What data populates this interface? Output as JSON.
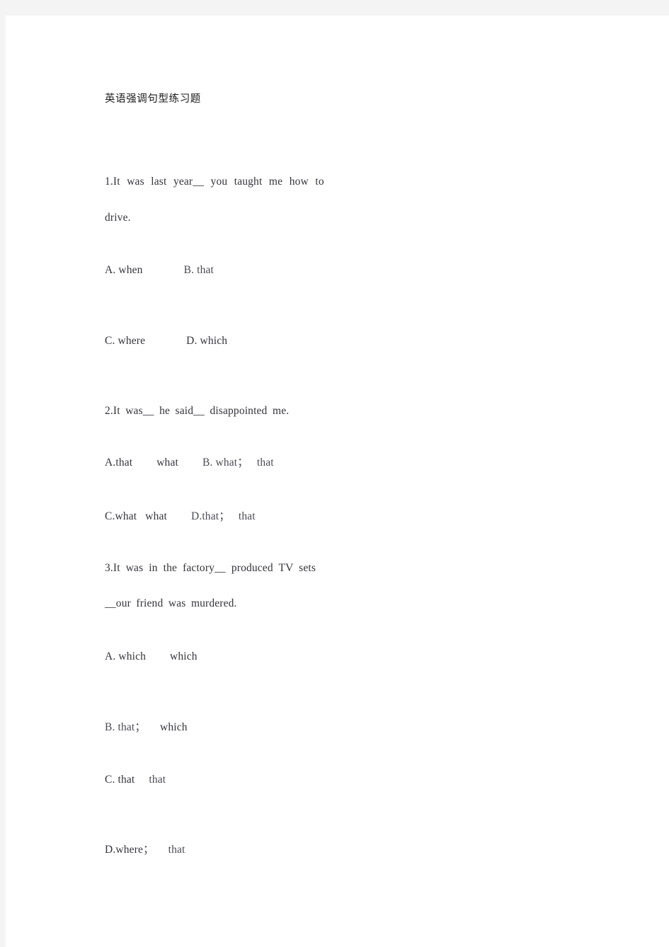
{
  "document": {
    "title": "英语强调句型练习题",
    "questions": [
      {
        "stem_line_1": "1.It was last year__ you taught me how to",
        "stem_line_2": "drive.",
        "option_a_label": "A. when",
        "option_b_label": "B. that",
        "option_c_label": "C. where",
        "option_d_label": "D. which"
      },
      {
        "stem_line_1": "2.It was__ he said__ disappointed me.",
        "option_a_first": "A.that",
        "option_a_second": "what",
        "option_b_first": "B. what",
        "option_b_sep": "；",
        "option_b_second": "that",
        "option_c_first": "C.what",
        "option_c_second": "what",
        "option_d_first": "D.that",
        "option_d_sep": "；",
        "option_d_second": "that"
      },
      {
        "stem_line_1": "3.It was in the factory__ produced TV sets",
        "stem_line_2": "__our friend was murdered.",
        "option_a_first": "A. which",
        "option_a_second": "which",
        "option_b_first": "B. that",
        "option_b_sep": "；",
        "option_b_second": "which",
        "option_c_first": "C. that",
        "option_c_second": "that",
        "option_d_first": "D.where",
        "option_d_sep": "；",
        "option_d_second": "that"
      }
    ]
  },
  "colors": {
    "page_background": "#ffffff",
    "canvas_background": "#f4f4f4",
    "title_text": "#1a1a1a",
    "body_text": "#33333c"
  }
}
